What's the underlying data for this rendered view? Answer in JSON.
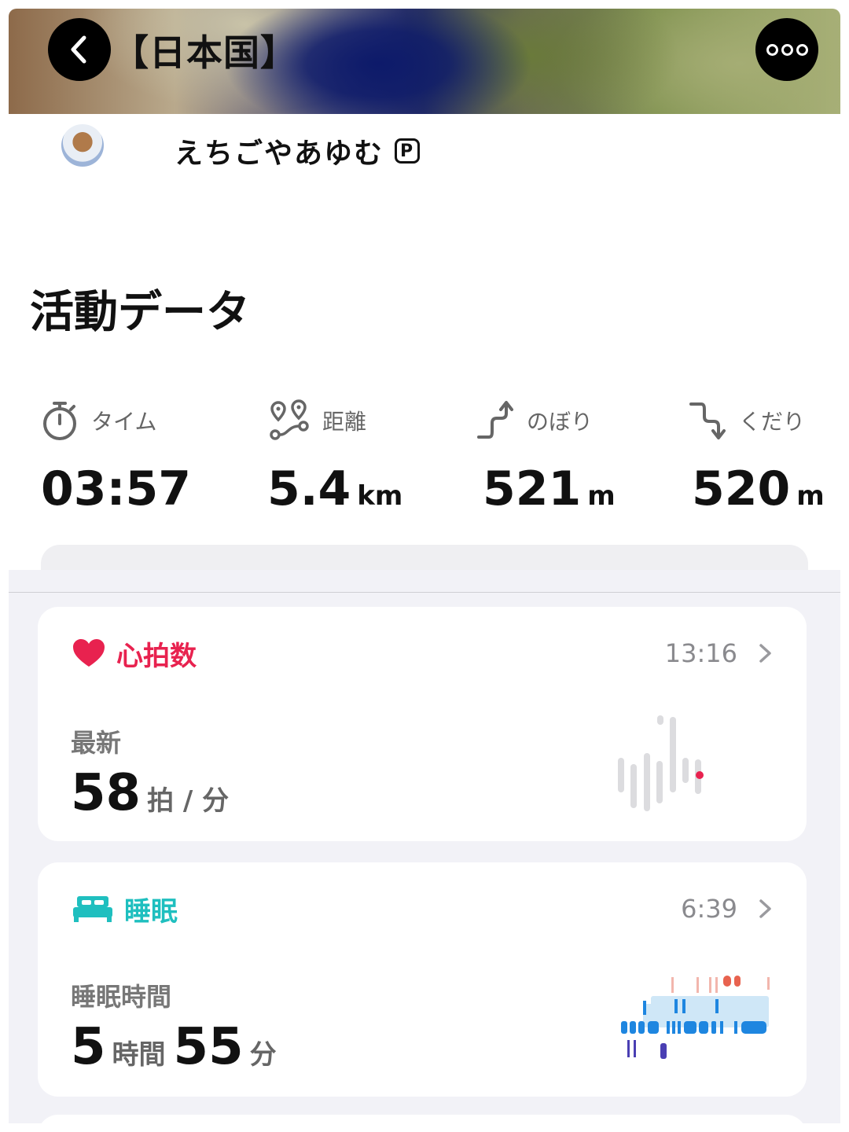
{
  "header": {
    "title": "【日本国】",
    "back_icon": "chevron-left-icon",
    "more_icon": "more-icon"
  },
  "user": {
    "name": "えちごやあゆむ",
    "badge": "P"
  },
  "activity": {
    "title": "活動データ",
    "stats": [
      {
        "icon": "stopwatch-icon",
        "label": "タイム",
        "value": "03:57",
        "unit": ""
      },
      {
        "icon": "route-icon",
        "label": "距離",
        "value": "5.4",
        "unit": "km"
      },
      {
        "icon": "ascent-icon",
        "label": "のぼり",
        "value": "521",
        "unit": "m"
      },
      {
        "icon": "descent-icon",
        "label": "くだり",
        "value": "520",
        "unit": "m"
      }
    ]
  },
  "heart": {
    "title": "心拍数",
    "time": "13:16",
    "sub": "最新",
    "value": "58",
    "unit": "拍 / 分",
    "color": "#e8224f"
  },
  "sleep": {
    "title": "睡眠",
    "time": "6:39",
    "sub": "睡眠時間",
    "hours": "5",
    "hours_unit": "時間",
    "minutes": "55",
    "minutes_unit": "分",
    "color": "#1fbfbf"
  }
}
